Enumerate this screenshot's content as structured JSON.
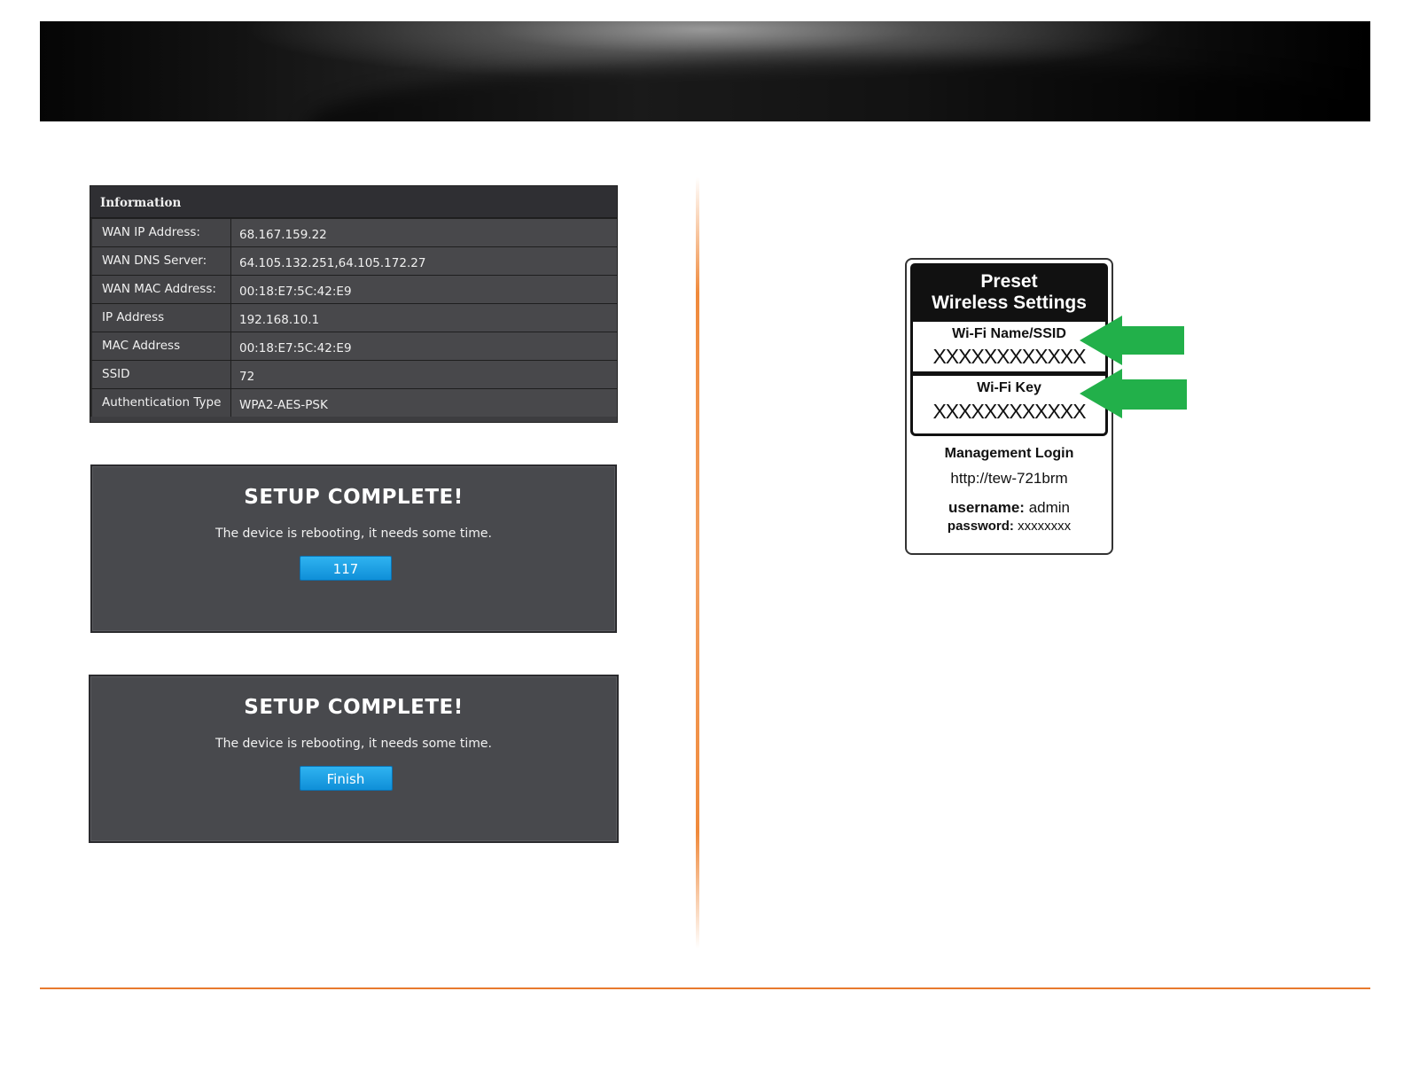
{
  "info": {
    "header": "Information",
    "rows": [
      {
        "label": "WAN IP Address:",
        "value": "68.167.159.22"
      },
      {
        "label": "WAN DNS Server:",
        "value": "64.105.132.251,64.105.172.27"
      },
      {
        "label": "WAN MAC Address:",
        "value": "00:18:E7:5C:42:E9"
      },
      {
        "label": "IP Address",
        "value": "192.168.10.1"
      },
      {
        "label": "MAC Address",
        "value": "00:18:E7:5C:42:E9"
      },
      {
        "label": "SSID",
        "value": "72"
      },
      {
        "label": "Authentication Type",
        "value": "WPA2-AES-PSK"
      }
    ]
  },
  "setup1": {
    "title": "SETUP COMPLETE!",
    "message": "The device is rebooting, it needs some time.",
    "countdown": "117"
  },
  "setup2": {
    "title": "SETUP COMPLETE!",
    "message": "The device is rebooting, it needs some time.",
    "button": "Finish"
  },
  "sticker": {
    "title_line1": "Preset",
    "title_line2": "Wireless Settings",
    "ssid_label": "Wi-Fi Name/SSID",
    "ssid_value": "XXXXXXXXXXXX",
    "key_label": "Wi-Fi Key",
    "key_value": "XXXXXXXXXXXX",
    "mgmt_label": "Management Login",
    "url": "http://tew-721brm",
    "username_label": "username:",
    "username_value": "admin",
    "password_label": "password:",
    "password_value": "xxxxxxxx"
  },
  "colors": {
    "accent_orange": "#e87a2e",
    "button_blue": "#1ca0e4",
    "arrow_green": "#22b04a",
    "panel_bg": "#48494d"
  }
}
